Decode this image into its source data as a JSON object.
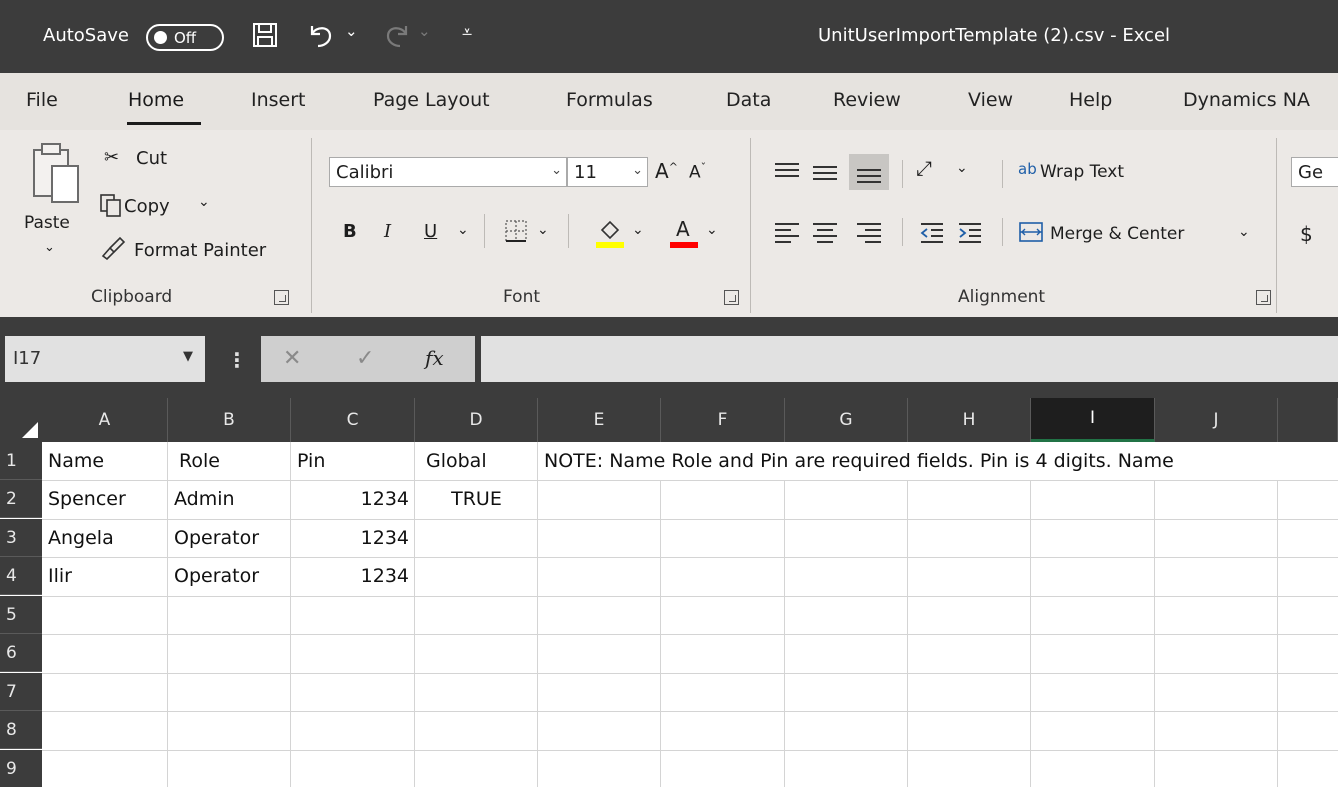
{
  "titlebar": {
    "autosave_label": "AutoSave",
    "autosave_state": "Off",
    "title": "UnitUserImportTemplate (2).csv  -  Excel"
  },
  "menu": {
    "tabs": [
      "File",
      "Home",
      "Insert",
      "Page Layout",
      "Formulas",
      "Data",
      "Review",
      "View",
      "Help",
      "Dynamics NA"
    ],
    "active": "Home"
  },
  "ribbon": {
    "clipboard": {
      "paste": "Paste",
      "cut": "Cut",
      "copy": "Copy",
      "format_painter": "Format Painter",
      "group_label": "Clipboard"
    },
    "font": {
      "font_name": "Calibri",
      "font_size": "11",
      "bold": "B",
      "italic": "I",
      "underline": "U",
      "group_label": "Font",
      "highlight_color": "#ffff00",
      "font_color": "#ff0000"
    },
    "alignment": {
      "wrap_text": "Wrap Text",
      "merge_center": "Merge & Center",
      "group_label": "Alignment"
    },
    "number": {
      "format_partial": "Ge",
      "currency": "$"
    }
  },
  "formula_bar": {
    "name_box": "I17",
    "fx": "fx",
    "formula": ""
  },
  "sheet": {
    "columns": [
      "A",
      "B",
      "C",
      "D",
      "E",
      "F",
      "G",
      "H",
      "I",
      "J"
    ],
    "selected_column": "I",
    "rows": [
      "1",
      "2",
      "3",
      "4",
      "5",
      "6",
      "7",
      "8",
      "9"
    ],
    "cells": {
      "r1": [
        "Name",
        "Role",
        "Pin",
        "Global",
        "NOTE: Name Role and Pin are required fields. Pin is 4 digits. Name"
      ],
      "r2": [
        "Spencer",
        "Admin",
        "1234",
        "TRUE"
      ],
      "r3": [
        "Angela",
        "Operator",
        "1234",
        ""
      ],
      "r4": [
        "Ilir",
        "Operator",
        "1234",
        ""
      ]
    }
  }
}
